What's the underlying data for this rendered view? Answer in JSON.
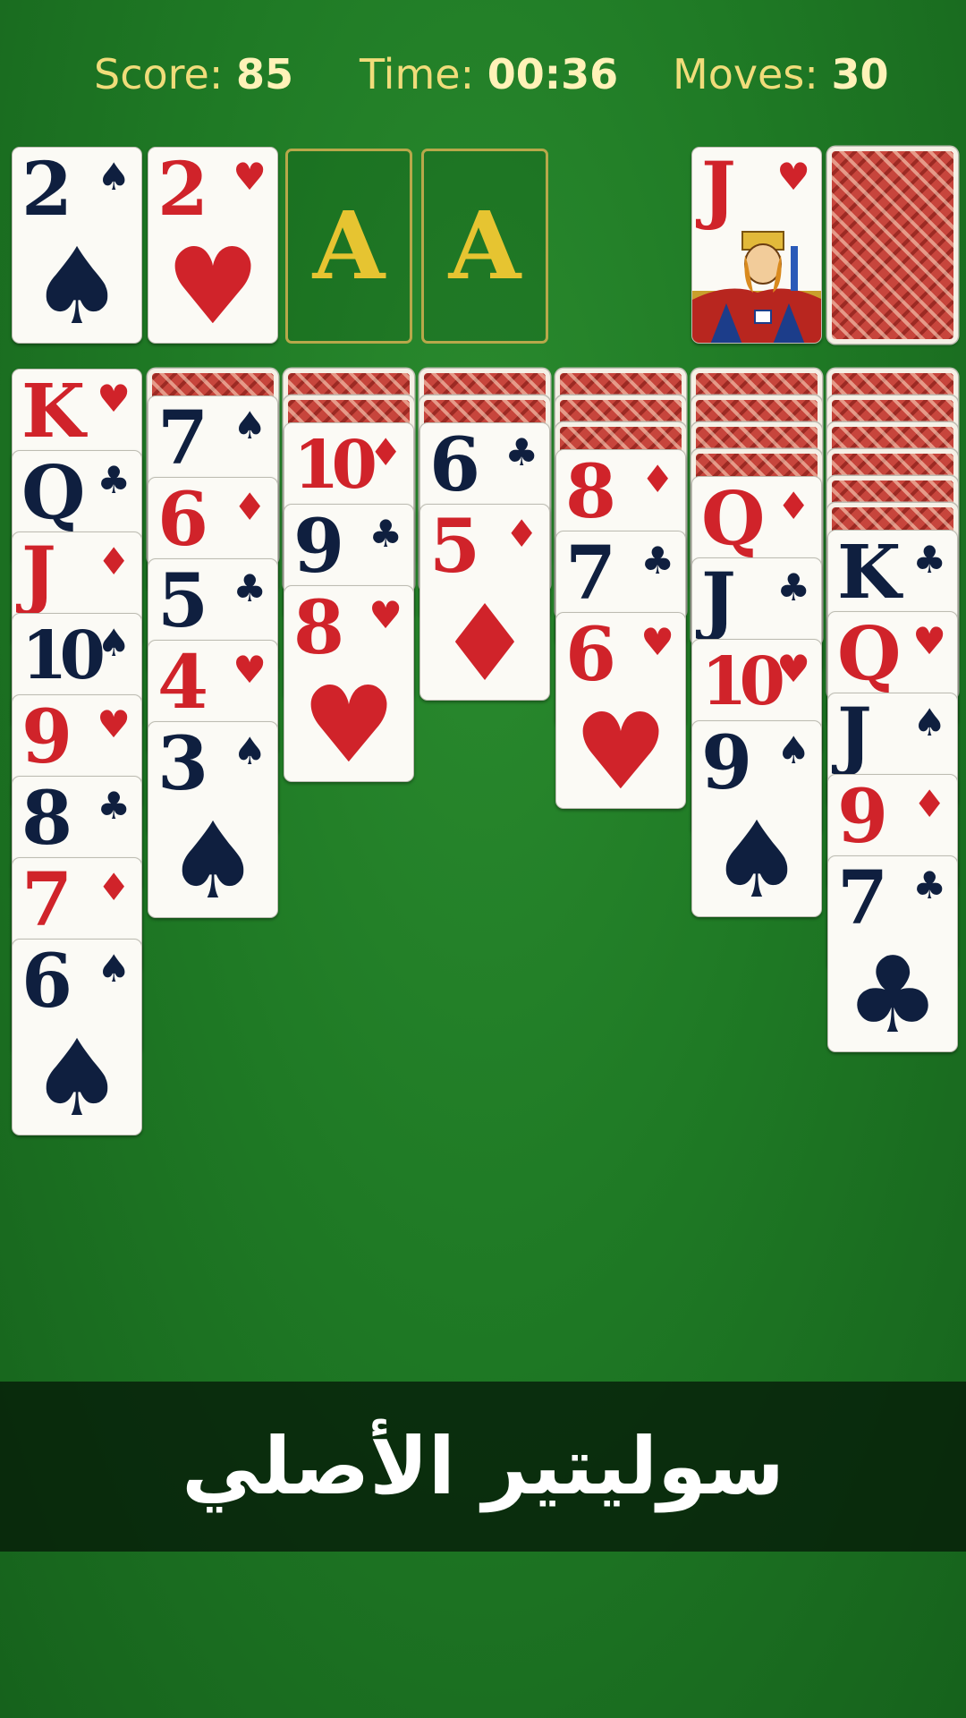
{
  "hud": {
    "score_label": "Score:",
    "score_value": "85",
    "time_label": "Time:",
    "time_value": "00:36",
    "moves_label": "Moves:",
    "moves_value": "30"
  },
  "colors": {
    "felt": "#1f7a25",
    "red_suit": "#d0232a",
    "black_suit": "#0f1f3f",
    "gold": "#e6c431"
  },
  "foundations": [
    {
      "type": "card",
      "rank": "2",
      "suit": "♠",
      "color": "black"
    },
    {
      "type": "card",
      "rank": "2",
      "suit": "♥",
      "color": "red"
    },
    {
      "type": "empty",
      "label": "A"
    },
    {
      "type": "empty",
      "label": "A"
    }
  ],
  "waste": {
    "rank": "J",
    "suit": "♥",
    "color": "red",
    "face_art": "jack-of-hearts-illustration"
  },
  "stock": {
    "face_down": true
  },
  "tableau": [
    {
      "hidden": 0,
      "cards": [
        {
          "rank": "K",
          "suit": "♥",
          "color": "red"
        },
        {
          "rank": "Q",
          "suit": "♣",
          "color": "black"
        },
        {
          "rank": "J",
          "suit": "♦",
          "color": "red"
        },
        {
          "rank": "10",
          "suit": "♠",
          "color": "black"
        },
        {
          "rank": "9",
          "suit": "♥",
          "color": "red"
        },
        {
          "rank": "8",
          "suit": "♣",
          "color": "black"
        },
        {
          "rank": "7",
          "suit": "♦",
          "color": "red"
        },
        {
          "rank": "6",
          "suit": "♠",
          "color": "black"
        }
      ]
    },
    {
      "hidden": 1,
      "cards": [
        {
          "rank": "7",
          "suit": "♠",
          "color": "black"
        },
        {
          "rank": "6",
          "suit": "♦",
          "color": "red"
        },
        {
          "rank": "5",
          "suit": "♣",
          "color": "black"
        },
        {
          "rank": "4",
          "suit": "♥",
          "color": "red"
        },
        {
          "rank": "3",
          "suit": "♠",
          "color": "black"
        }
      ]
    },
    {
      "hidden": 2,
      "cards": [
        {
          "rank": "10",
          "suit": "♦",
          "color": "red"
        },
        {
          "rank": "9",
          "suit": "♣",
          "color": "black"
        },
        {
          "rank": "8",
          "suit": "♥",
          "color": "red"
        }
      ]
    },
    {
      "hidden": 2,
      "cards": [
        {
          "rank": "6",
          "suit": "♣",
          "color": "black"
        },
        {
          "rank": "5",
          "suit": "♦",
          "color": "red"
        }
      ]
    },
    {
      "hidden": 3,
      "cards": [
        {
          "rank": "8",
          "suit": "♦",
          "color": "red"
        },
        {
          "rank": "7",
          "suit": "♣",
          "color": "black"
        },
        {
          "rank": "6",
          "suit": "♥",
          "color": "red"
        }
      ]
    },
    {
      "hidden": 4,
      "cards": [
        {
          "rank": "Q",
          "suit": "♦",
          "color": "red"
        },
        {
          "rank": "J",
          "suit": "♣",
          "color": "black"
        },
        {
          "rank": "10",
          "suit": "♥",
          "color": "red"
        },
        {
          "rank": "9",
          "suit": "♠",
          "color": "black"
        }
      ]
    },
    {
      "hidden": 6,
      "cards": [
        {
          "rank": "K",
          "suit": "♣",
          "color": "black"
        },
        {
          "rank": "Q",
          "suit": "♥",
          "color": "red"
        },
        {
          "rank": "J",
          "suit": "♠",
          "color": "black"
        },
        {
          "rank": "9",
          "suit": "♦",
          "color": "red"
        },
        {
          "rank": "7",
          "suit": "♣",
          "color": "black"
        }
      ]
    }
  ],
  "banner": {
    "text": "سوليتير الأصلي"
  }
}
